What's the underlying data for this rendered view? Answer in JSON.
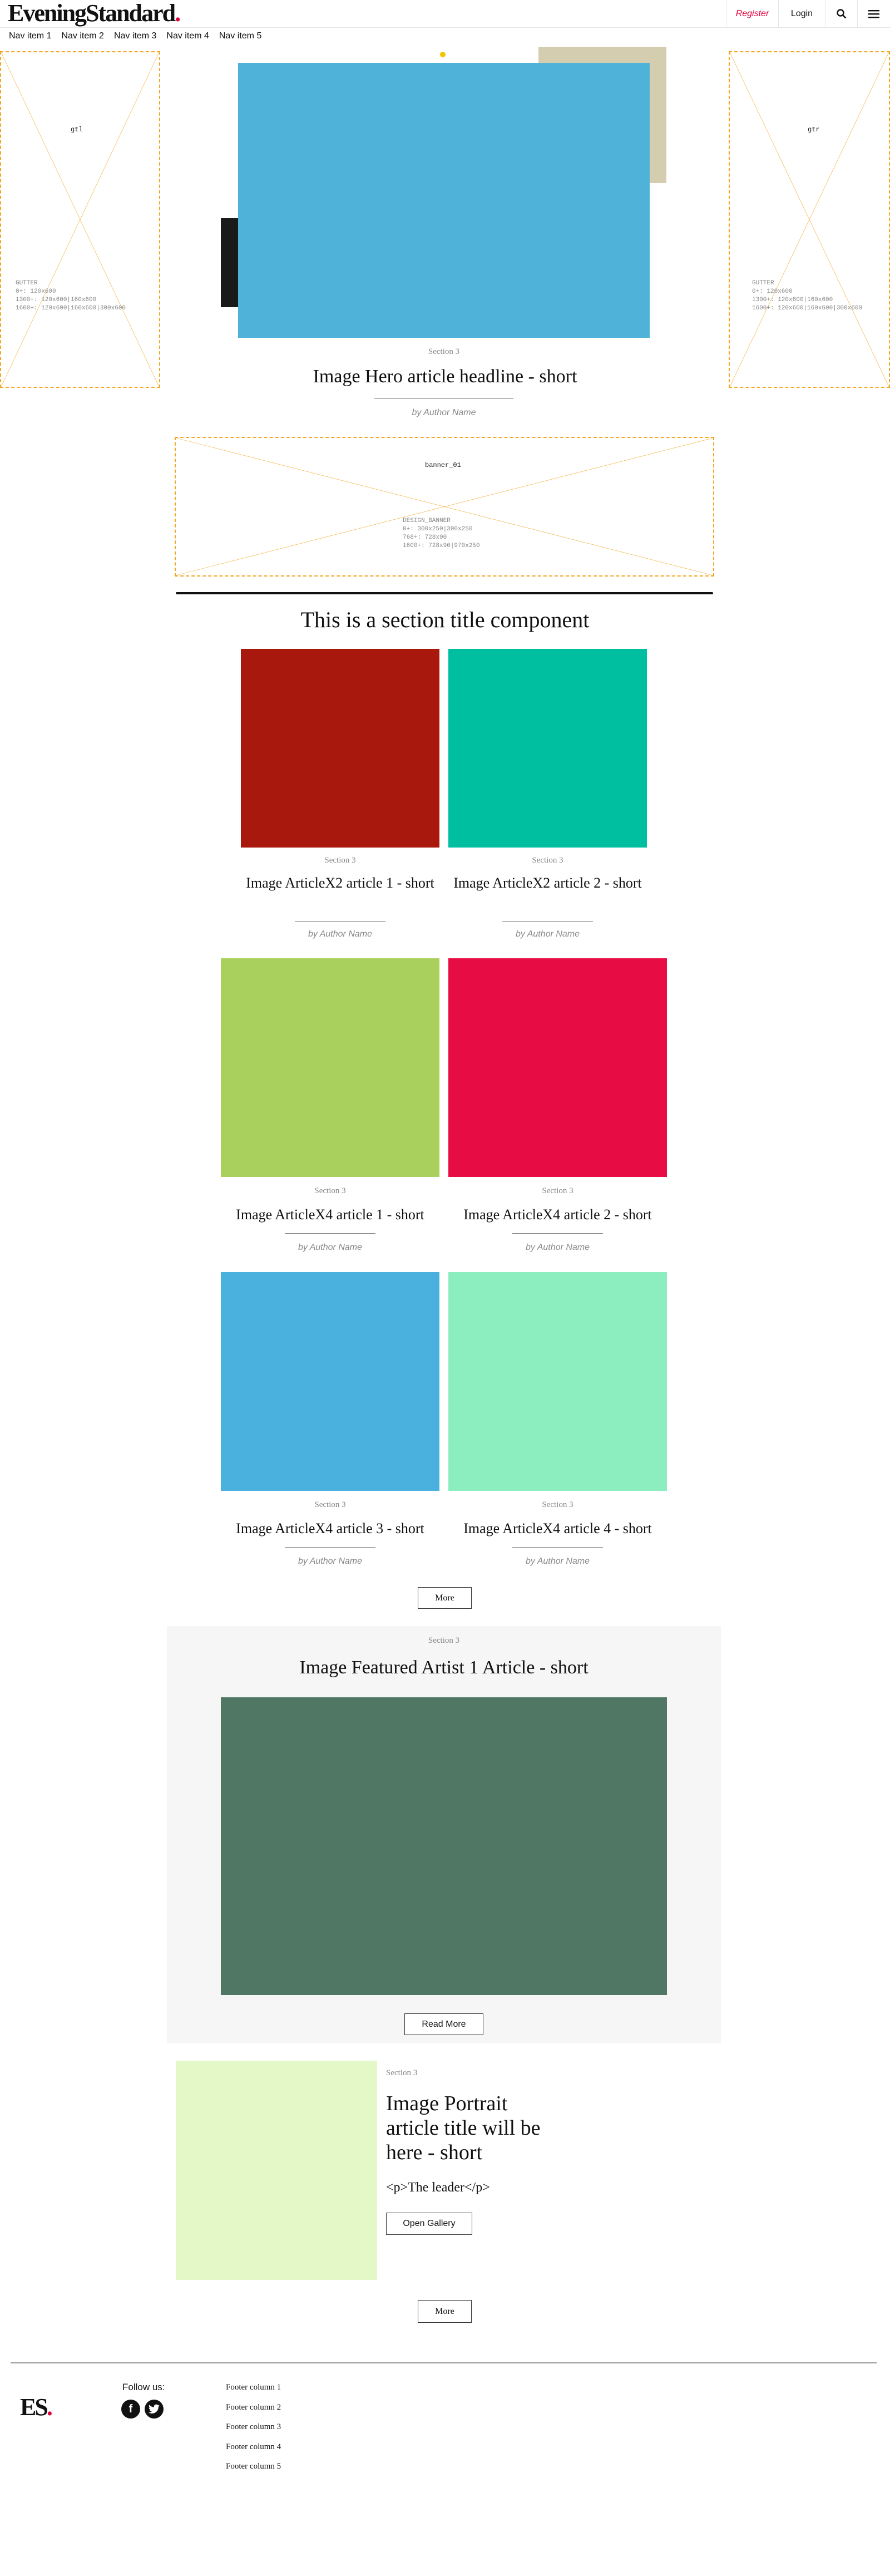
{
  "header": {
    "logo_text": "EveningStandard",
    "logo_dot": ".",
    "register_label": "Register",
    "login_label": "Login",
    "search_icon": "search-icon",
    "menu_icon": "hamburger-menu-icon"
  },
  "nav": [
    "Nav item 1",
    "Nav item 2",
    "Nav item 3",
    "Nav item 4",
    "Nav item 5"
  ],
  "gutters": {
    "left": {
      "title": "gtl",
      "info": [
        "GUTTER",
        "0+: 120x600",
        "1300+: 120x600|160x600",
        "1600+: 120x600|160x600|300x600"
      ]
    },
    "right": {
      "title": "gtr",
      "info": [
        "GUTTER",
        "0+: 120x600",
        "1300+: 120x600|160x600",
        "1600+: 120x600|160x600|300x600"
      ]
    }
  },
  "hero": {
    "section": "Section 3",
    "headline": "Image Hero article headline - short",
    "author": "by Author Name",
    "colors": {
      "main": "#4fb3d9",
      "back": "#d5cdb0",
      "accent": "#1a1a1a"
    }
  },
  "banner": {
    "title": "banner_01",
    "info": [
      "DESIGN_BANNER",
      "0+: 300x250|300x250",
      "768+: 728x90",
      "1600+: 728x90|970x250"
    ]
  },
  "section_title": "This is a section title component",
  "articles_x2": [
    {
      "section": "Section 3",
      "title": "Image ArticleX2 article 1 - short",
      "author": "by Author Name",
      "color": "#a8180c"
    },
    {
      "section": "Section 3",
      "title": "Image ArticleX2 article 2 - short",
      "author": "by Author Name",
      "color": "#00bfa0"
    }
  ],
  "articles_x4": [
    {
      "section": "Section 3",
      "title": "Image ArticleX4 article 1 - short",
      "author": "by Author Name",
      "color": "#a9d05c"
    },
    {
      "section": "Section 3",
      "title": "Image ArticleX4 article 2 - short",
      "author": "by Author Name",
      "color": "#e80c44"
    },
    {
      "section": "Section 3",
      "title": "Image ArticleX4 article 3 - short",
      "author": "by Author Name",
      "color": "#4ab1de"
    },
    {
      "section": "Section 3",
      "title": "Image ArticleX4 article 4 - short",
      "author": "by Author Name",
      "color": "#8cedbf"
    }
  ],
  "more_label_1": "More",
  "featured": {
    "section": "Section 3",
    "title": "Image Featured Artist 1 Article - short",
    "read_more": "Read More",
    "color": "#4f7764"
  },
  "portrait": {
    "section": "Section 3",
    "title": "Image Portrait article title will be here - short",
    "leader": "<p>The leader</p>",
    "button": "Open Gallery",
    "color": "#e3f7c7"
  },
  "more_label_2": "More",
  "footer": {
    "logo": "ES",
    "logo_dot": ".",
    "follow_label": "Follow us:",
    "social": [
      "facebook-icon",
      "twitter-icon"
    ],
    "columns": [
      "Footer column 1",
      "Footer column 2",
      "Footer column 3",
      "Footer column 4",
      "Footer column 5"
    ]
  }
}
